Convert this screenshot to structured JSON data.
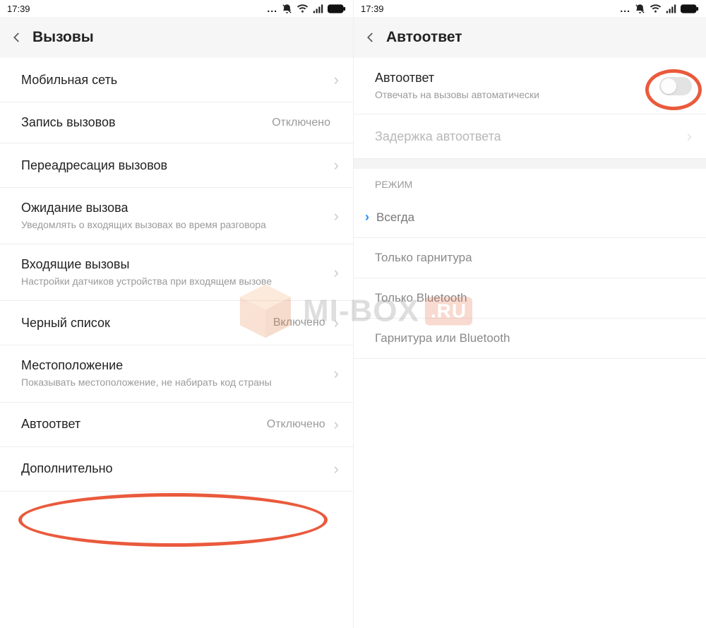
{
  "statusbar": {
    "time": "17:39",
    "dots": "..."
  },
  "left": {
    "header": {
      "title": "Вызовы"
    },
    "items": [
      {
        "title": "Мобильная сеть",
        "subtitle": "",
        "value": "",
        "arrow": true
      },
      {
        "title": "Запись вызовов",
        "subtitle": "",
        "value": "Отключено",
        "arrow": false
      },
      {
        "title": "Переадресация вызовов",
        "subtitle": "",
        "value": "",
        "arrow": true
      },
      {
        "title": "Ожидание вызова",
        "subtitle": "Уведомлять о входящих вызовах во время разговора",
        "value": "",
        "arrow": true
      },
      {
        "title": "Входящие вызовы",
        "subtitle": "Настройки датчиков устройства при входящем вызове",
        "value": "",
        "arrow": true
      },
      {
        "title": "Черный список",
        "subtitle": "",
        "value": "Включено",
        "arrow": true
      },
      {
        "title": "Местоположение",
        "subtitle": "Показывать местоположение, не набирать код страны",
        "value": "",
        "arrow": true
      },
      {
        "title": "Автоответ",
        "subtitle": "",
        "value": "Отключено",
        "arrow": true
      },
      {
        "title": "Дополнительно",
        "subtitle": "",
        "value": "",
        "arrow": true
      }
    ]
  },
  "right": {
    "header": {
      "title": "Автоответ"
    },
    "toggle_item": {
      "title": "Автоответ",
      "subtitle": "Отвечать на вызовы автоматически",
      "on": false
    },
    "delay_item": {
      "title": "Задержка автоответа"
    },
    "section_label": "РЕЖИМ",
    "modes": [
      {
        "label": "Всегда",
        "selected": true
      },
      {
        "label": "Только гарнитура",
        "selected": false
      },
      {
        "label": "Только Bluetooth",
        "selected": false
      },
      {
        "label": "Гарнитура или Bluetooth",
        "selected": false
      }
    ]
  },
  "watermark": {
    "t1": "MI-BOX",
    "t2": ".RU"
  },
  "highlight_color": "#ea5a3c"
}
